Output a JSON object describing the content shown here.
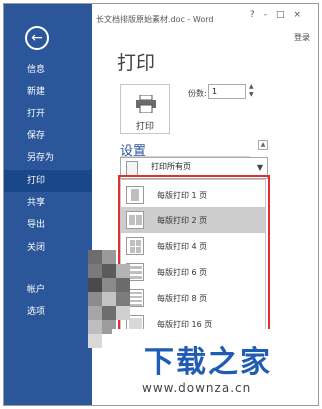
{
  "window": {
    "title": "长文档排版原始素材.doc - Word",
    "controls": [
      "?",
      "-",
      "□",
      "×"
    ],
    "login": "登录"
  },
  "sidebar": {
    "items": [
      {
        "label": "信息"
      },
      {
        "label": "新建"
      },
      {
        "label": "打开"
      },
      {
        "label": "保存"
      },
      {
        "label": "另存为"
      },
      {
        "label": "打印"
      },
      {
        "label": "共享"
      },
      {
        "label": "导出"
      },
      {
        "label": "关闭"
      },
      {
        "label": "帐户"
      },
      {
        "label": "选项"
      }
    ],
    "active": "打印",
    "back_icon": "back-arrow-icon"
  },
  "main": {
    "page_title": "打印",
    "print_button_label": "打印",
    "copies_label": "份数:",
    "copies_value": "1",
    "settings_title": "设置",
    "print_range_value": "打印所有页",
    "pages_per_sheet": {
      "options": [
        {
          "label": "每版打印 1 页"
        },
        {
          "label": "每版打印 2 页"
        },
        {
          "label": "每版打印 4 页"
        },
        {
          "label": "每版打印 6 页"
        },
        {
          "label": "每版打印 8 页"
        },
        {
          "label": "每版打印 16 页"
        }
      ],
      "selected": "每版打印 2 页"
    }
  },
  "watermark": {
    "title": "下载之家",
    "url": "www.downza.cn"
  },
  "colors": {
    "sidebar": "#2b579a",
    "sidebar_active": "#19478a",
    "accent": "#2b579a",
    "highlight": "#e03030",
    "selected_row": "#cdcdcd"
  }
}
